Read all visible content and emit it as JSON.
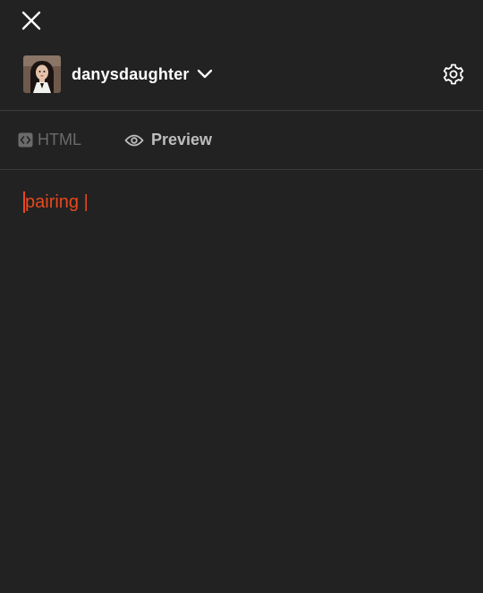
{
  "header": {
    "close_icon": "close-icon",
    "blog_name": "danysdaughter",
    "blog_switch_icon": "chevron-down-icon",
    "settings_icon": "gear-icon"
  },
  "tabs": [
    {
      "label": "HTML",
      "icon": "code-icon",
      "active": false
    },
    {
      "label": "Preview",
      "icon": "eye-icon",
      "active": true
    }
  ],
  "editor": {
    "text": "pairing |"
  },
  "colors": {
    "background": "#222222",
    "text": "#ffffff",
    "accent_text": "#e8491d",
    "divider": "#3c3c3c"
  }
}
